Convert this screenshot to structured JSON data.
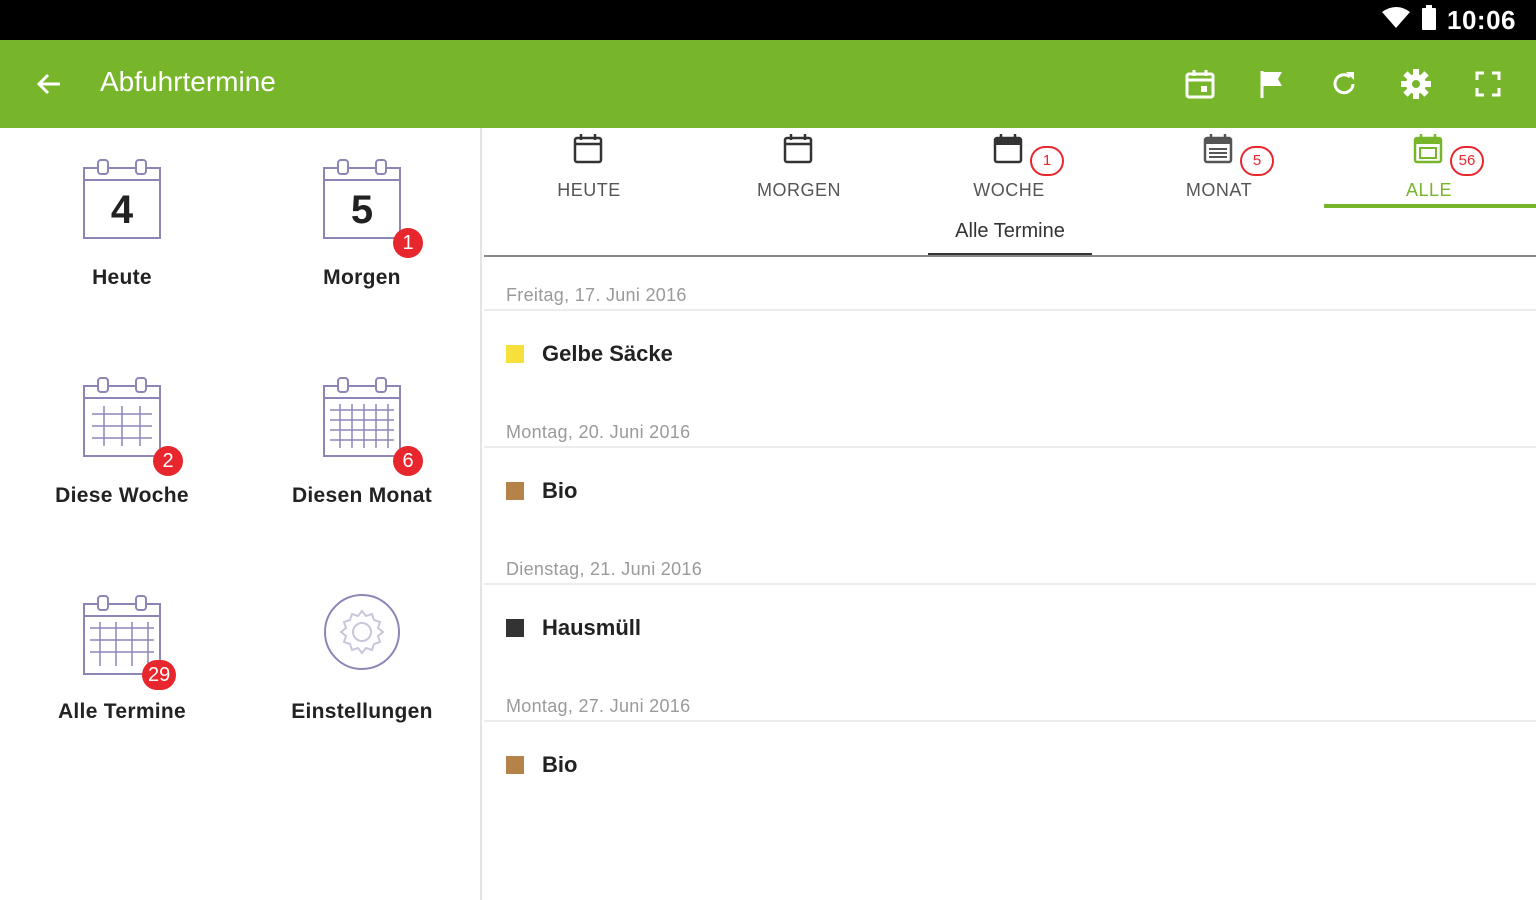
{
  "status_bar": {
    "time": "10:06"
  },
  "app_bar": {
    "title": "Abfuhrtermine",
    "actions": [
      "calendar-icon",
      "flag-icon",
      "refresh-icon",
      "settings-icon",
      "fullscreen-icon"
    ]
  },
  "colors": {
    "brand": "#77b52b",
    "badge": "#e8262d"
  },
  "left_menu": {
    "tiles": [
      {
        "label": "Heute",
        "day_number": "4",
        "badge": ""
      },
      {
        "label": "Morgen",
        "day_number": "5",
        "badge": "1"
      },
      {
        "label": "Diese Woche",
        "badge": "2"
      },
      {
        "label": "Diesen Monat",
        "badge": "6"
      },
      {
        "label": "Alle Termine",
        "badge": "29"
      },
      {
        "label": "Einstellungen",
        "badge": ""
      }
    ]
  },
  "tabs": [
    {
      "label": "HEUTE",
      "badge": ""
    },
    {
      "label": "MORGEN",
      "badge": ""
    },
    {
      "label": "WOCHE",
      "badge": "1"
    },
    {
      "label": "MONAT",
      "badge": "5"
    },
    {
      "label": "ALLE",
      "badge": "56",
      "active": true
    }
  ],
  "subtab": {
    "label": "Alle Termine"
  },
  "schedule": [
    {
      "date": "Freitag, 17. Juni 2016",
      "item": "Gelbe Säcke",
      "color": "#f7e03c"
    },
    {
      "date": "Montag, 20. Juni 2016",
      "item": "Bio",
      "color": "#b5834a"
    },
    {
      "date": "Dienstag, 21. Juni 2016",
      "item": "Hausmüll",
      "color": "#333333"
    },
    {
      "date": "Montag, 27. Juni 2016",
      "item": "Bio",
      "color": "#b5834a"
    }
  ]
}
